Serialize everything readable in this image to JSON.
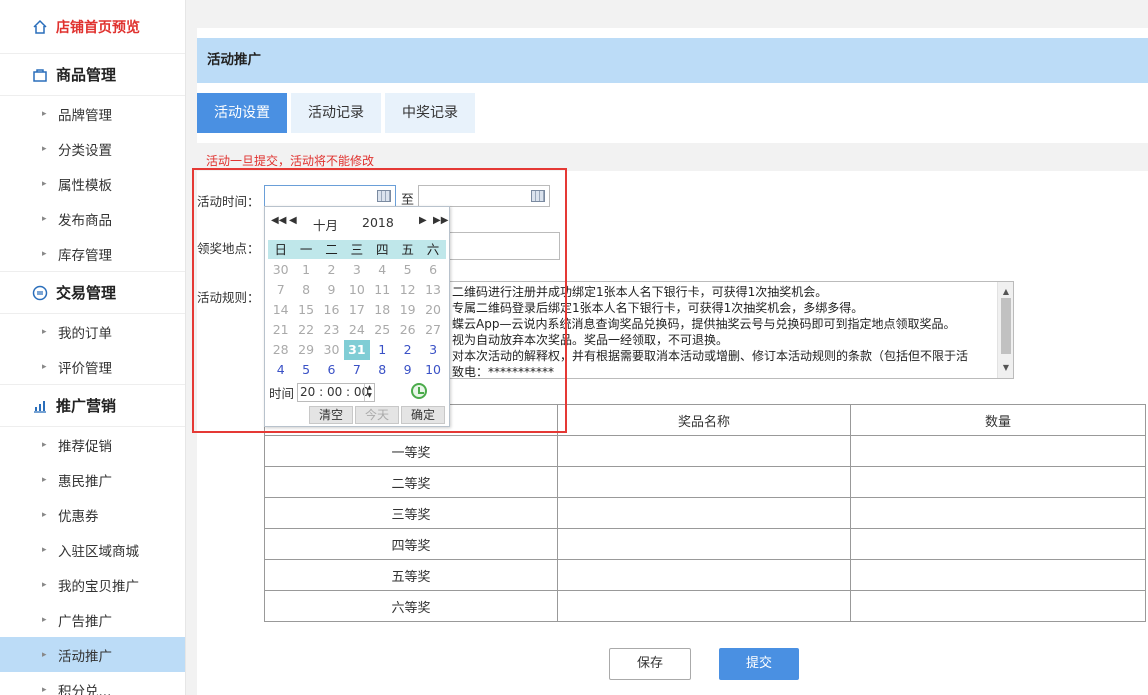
{
  "sidebar": {
    "home": "店铺首页预览",
    "groups": [
      {
        "title": "商品管理",
        "items": [
          "品牌管理",
          "分类设置",
          "属性模板",
          "发布商品",
          "库存管理"
        ]
      },
      {
        "title": "交易管理",
        "items": [
          "我的订单",
          "评价管理"
        ]
      },
      {
        "title": "推广营销",
        "items": [
          "推荐促销",
          "惠民推广",
          "优惠券",
          "入驻区域商城",
          "我的宝贝推广",
          "广告推广",
          "活动推广",
          "积分兑..."
        ]
      }
    ],
    "active_item": "活动推广"
  },
  "panel": {
    "title": "活动推广",
    "tabs": [
      "活动设置",
      "活动记录",
      "中奖记录"
    ],
    "active_tab": "活动设置",
    "warning": "活动一旦提交，活动将不能修改"
  },
  "form": {
    "time_label": "活动时间：",
    "to": "至",
    "place_label": "领奖地点：",
    "rules_label": "活动规则：",
    "rules_lines": [
      "二维码进行注册并成功绑定1张本人名下银行卡，可获得1次抽奖机会。",
      "专属二维码登录后绑定1张本人名下银行卡，可获得1次抽奖机会，多绑多得。",
      "蝶云App—云说内系统消息查询奖品兑换码，提供抽奖云号与兑换码即可到指定地点领取奖品。",
      "视为自动放弃本次奖品。奖品一经领取，不可退换。",
      "对本次活动的解释权，并有根据需要取消本活动或增删、修订本活动规则的条款（包括但不限于活",
      "致电：***********"
    ]
  },
  "table": {
    "headers": [
      "奖品名称",
      "数量"
    ],
    "rows": [
      "一等奖",
      "二等奖",
      "三等奖",
      "四等奖",
      "五等奖",
      "六等奖"
    ]
  },
  "buttons": {
    "save": "保存",
    "submit": "提交"
  },
  "datepicker": {
    "month": "十月",
    "year": "2018",
    "weekdays": [
      "日",
      "一",
      "二",
      "三",
      "四",
      "五",
      "六"
    ],
    "weeks": [
      [
        [
          "30",
          "off"
        ],
        [
          "1",
          "off"
        ],
        [
          "2",
          "off"
        ],
        [
          "3",
          "off"
        ],
        [
          "4",
          "off"
        ],
        [
          "5",
          "off"
        ],
        [
          "6",
          "off"
        ]
      ],
      [
        [
          "7",
          "off"
        ],
        [
          "8",
          "off"
        ],
        [
          "9",
          "off"
        ],
        [
          "10",
          "off"
        ],
        [
          "11",
          "off"
        ],
        [
          "12",
          "off"
        ],
        [
          "13",
          "off"
        ]
      ],
      [
        [
          "14",
          "off"
        ],
        [
          "15",
          "off"
        ],
        [
          "16",
          "off"
        ],
        [
          "17",
          "off"
        ],
        [
          "18",
          "off"
        ],
        [
          "19",
          "off"
        ],
        [
          "20",
          "off"
        ]
      ],
      [
        [
          "21",
          "off"
        ],
        [
          "22",
          "off"
        ],
        [
          "23",
          "off"
        ],
        [
          "24",
          "off"
        ],
        [
          "25",
          "off"
        ],
        [
          "26",
          "off"
        ],
        [
          "27",
          "off"
        ]
      ],
      [
        [
          "28",
          "off"
        ],
        [
          "29",
          "off"
        ],
        [
          "30",
          "off"
        ],
        [
          "31",
          "sel"
        ],
        [
          "1",
          "on"
        ],
        [
          "2",
          "on"
        ],
        [
          "3",
          "on"
        ]
      ],
      [
        [
          "4",
          "on"
        ],
        [
          "5",
          "on"
        ],
        [
          "6",
          "on"
        ],
        [
          "7",
          "on"
        ],
        [
          "8",
          "on"
        ],
        [
          "9",
          "on"
        ],
        [
          "10",
          "on"
        ]
      ]
    ],
    "time_label": "时间",
    "time_value": "20 : 00 : 00",
    "clear": "清空",
    "today": "今天",
    "ok": "确定"
  },
  "colors": {
    "accent": "#4a90e2",
    "warning": "#e0322f",
    "highlight": "#e53935"
  }
}
